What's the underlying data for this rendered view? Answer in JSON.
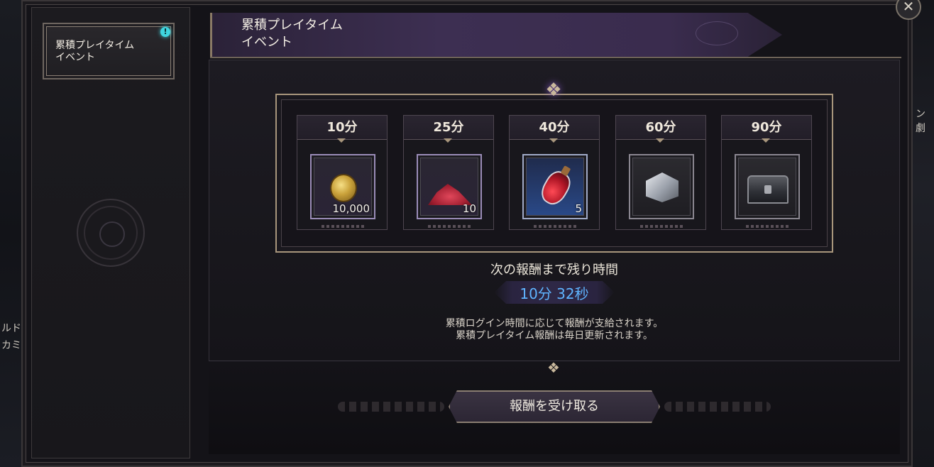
{
  "background": {
    "left_edge_lines": [
      "ルド",
      "カミ"
    ],
    "right_edge_text": "ン劇"
  },
  "sidebar": {
    "items": [
      {
        "line1": "累積プレイタイム",
        "line2": "イベント",
        "alert": "!"
      }
    ]
  },
  "header": {
    "title_line1": "累積プレイタイム",
    "title_line2": "イベント",
    "close_label": "✕"
  },
  "rewards": [
    {
      "time": "10分",
      "count": "10,000",
      "icon": "gold-coin-icon"
    },
    {
      "time": "25分",
      "count": "10",
      "icon": "red-powder-icon"
    },
    {
      "time": "40分",
      "count": "5",
      "icon": "red-potion-icon"
    },
    {
      "time": "60分",
      "count": "",
      "icon": "silver-box-icon"
    },
    {
      "time": "90分",
      "count": "",
      "icon": "iron-chest-icon"
    }
  ],
  "timer": {
    "label": "次の報酬まで残り時間",
    "value": "10分 32秒"
  },
  "info": {
    "line1": "累積ログイン時間に応じて報酬が支給されます。",
    "line2": "累積プレイタイム報酬は毎日更新されます。"
  },
  "claim_button": {
    "label": "報酬を受け取る"
  },
  "colors": {
    "accent_gold": "#a8967c",
    "timer_blue": "#5fb4ff",
    "title_purple": "#3d2f52",
    "alert_cyan": "#3fd6e0"
  }
}
